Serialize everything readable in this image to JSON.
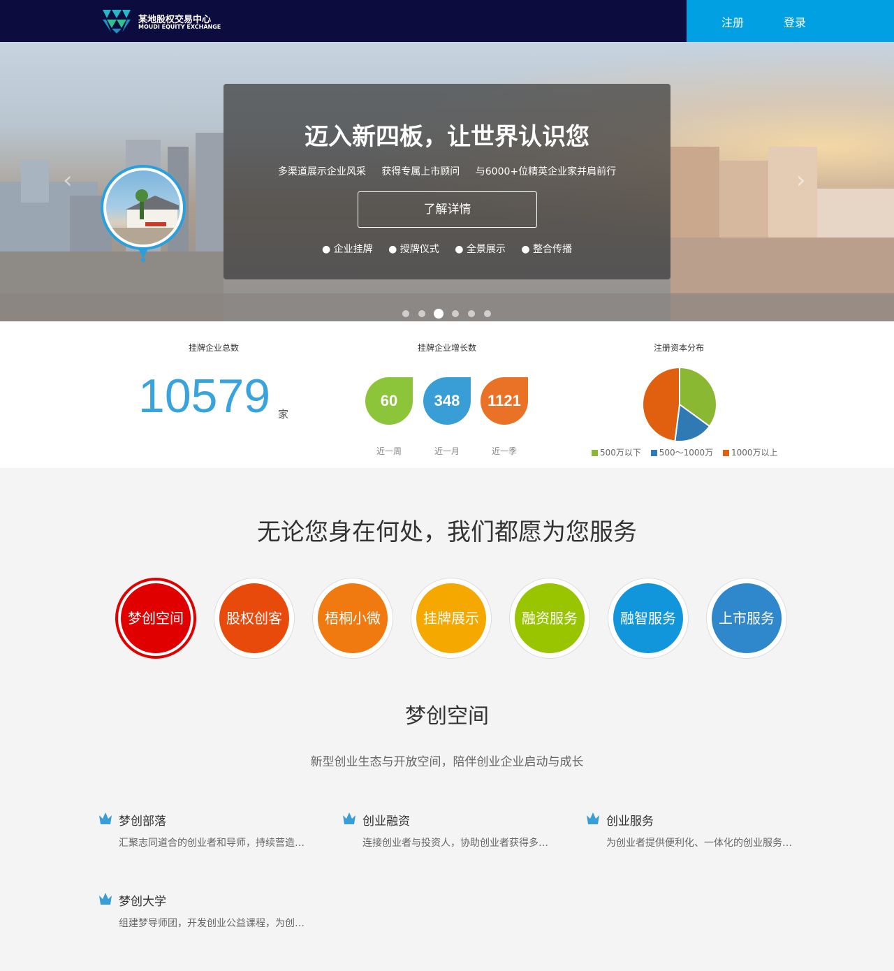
{
  "header": {
    "logo_cn": "某地股权交易中心",
    "logo_en": "MOUDI EQUITY EXCHANGE",
    "register": "注册",
    "login": "登录",
    "colors": {
      "bg": "#0c0c3e",
      "auth_bg": "#00a0e2"
    }
  },
  "hero": {
    "title": "迈入新四板，让世界认识您",
    "subtitle": [
      "多渠道展示企业风采",
      "获得专属上市顾问",
      "与6000+位精英企业家并肩前行"
    ],
    "button": "了解详情",
    "tags": [
      "● 企业挂牌",
      "● 授牌仪式",
      "● 全景展示",
      "● 整合传播"
    ],
    "arrow_left": "‹",
    "arrow_right": "›",
    "slide_count": 6,
    "active_slide": 3
  },
  "stats": {
    "total": {
      "title": "挂牌企业总数",
      "value": "10579",
      "unit": "家"
    },
    "growth": {
      "title": "挂牌企业增长数",
      "items": [
        {
          "value": "60",
          "label": "近一周",
          "color": "#8cc43a"
        },
        {
          "value": "348",
          "label": "近一月",
          "color": "#3a9ed6"
        },
        {
          "value": "1121",
          "label": "近一季",
          "color": "#ea7227"
        }
      ]
    },
    "capital": {
      "title": "注册资本分布",
      "legend": [
        {
          "label": "500万以下",
          "color": "#8ab833"
        },
        {
          "label": "500～1000万",
          "color": "#2f7ab5"
        },
        {
          "label": "1000万以上",
          "color": "#e0600f"
        }
      ]
    }
  },
  "chart_data": {
    "type": "pie",
    "title": "注册资本分布",
    "categories": [
      "500万以下",
      "500～1000万",
      "1000万以上"
    ],
    "values": [
      35,
      17,
      48
    ],
    "colors": [
      "#8ab833",
      "#2f7ab5",
      "#e0600f"
    ],
    "legend_position": "bottom"
  },
  "services": {
    "title": "无论您身在何处，我们都愿为您服务",
    "items": [
      {
        "label": "梦创空间",
        "color": "#e00000",
        "active": true
      },
      {
        "label": "股权创客",
        "color": "#e84a0c"
      },
      {
        "label": "梧桐小微",
        "color": "#f07a0f"
      },
      {
        "label": "挂牌展示",
        "color": "#f5a800"
      },
      {
        "label": "融资服务",
        "color": "#99c400"
      },
      {
        "label": "融智服务",
        "color": "#1196dc"
      },
      {
        "label": "上市服务",
        "color": "#2f87cc"
      }
    ]
  },
  "section": {
    "title": "梦创空间",
    "subtitle": "新型创业生态与开放空间，陪伴创业企业启动与成长",
    "features": [
      {
        "title": "梦创部落",
        "desc": "汇聚志同道合的创业者和导师，持续营造…"
      },
      {
        "title": "创业融资",
        "desc": "连接创业者与投资人，协助创业者获得多…"
      },
      {
        "title": "创业服务",
        "desc": "为创业者提供便利化、一体化的创业服务…"
      },
      {
        "title": "梦创大学",
        "desc": "组建梦导师团，开发创业公益课程，为创…"
      }
    ],
    "icon": "crown-icon",
    "icon_color": "#3a9ed6"
  }
}
